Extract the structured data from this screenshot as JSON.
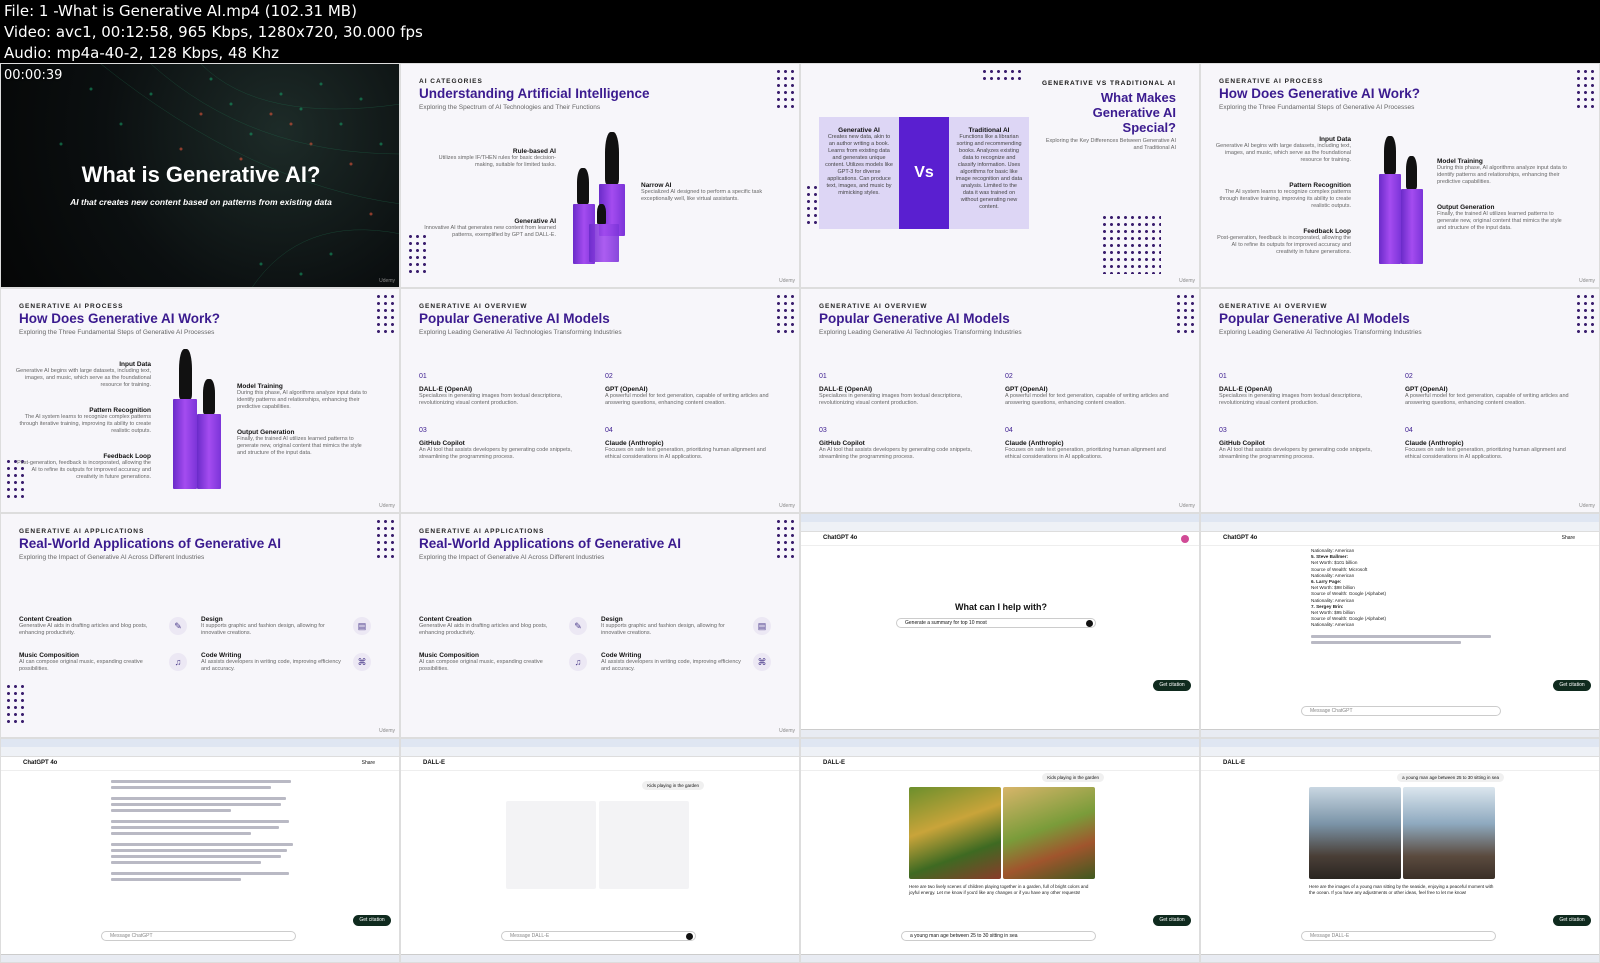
{
  "file_info": {
    "line1": "File: 1 -What is Generative AI.mp4 (102.31 MB)",
    "line2": "Video: avc1, 00:12:58, 965 Kbps, 1280x720, 30.000 fps",
    "line3": "Audio: mp4a-40-2, 128 Kbps, 48 Khz",
    "timestamp": "00:00:39"
  },
  "watermark": "Udemy",
  "tile1": {
    "title": "What is Generative AI?",
    "subtitle": "AI that creates new content based on patterns from existing data"
  },
  "tile2": {
    "kicker": "AI CATEGORIES",
    "title": "Understanding Artificial Intelligence",
    "subtitle": "Exploring the Spectrum of AI Technologies and Their Functions",
    "items": [
      {
        "label": "Rule-based AI",
        "desc": "Utilizes simple IF/THEN rules for basic decision-making, suitable for limited tasks."
      },
      {
        "label": "Narrow AI",
        "desc": "Specialized AI designed to perform a specific task exceptionally well, like virtual assistants."
      },
      {
        "label": "Generative AI",
        "desc": "Innovative AI that generates new content from learned patterns, exemplified by GPT and DALL-E."
      }
    ]
  },
  "tile3": {
    "kicker": "GENERATIVE VS TRADITIONAL AI",
    "title": "What Makes Generative AI Special?",
    "subtitle": "Exploring the Key Differences Between Generative AI and Traditional AI",
    "left_head": "Generative AI",
    "left_text": "Creates new data, akin to an author writing a book. Learns from existing data and generates unique content. Utilizes models like GPT-3 for diverse applications. Can produce text, images, and music by mimicking styles.",
    "vs": "Vs",
    "right_head": "Traditional AI",
    "right_text": "Functions like a librarian sorting and recommending books. Analyzes existing data to recognize and classify information. Uses algorithms for basic like image recognition and data analysis. Limited to the data it was trained on without generating new content."
  },
  "process": {
    "kicker": "GENERATIVE AI PROCESS",
    "title": "How Does Generative AI Work?",
    "subtitle": "Exploring the Three Fundamental Steps of Generative AI Processes",
    "steps": [
      {
        "label": "Input Data",
        "desc": "Generative AI begins with large datasets, including text, images, and music, which serve as the foundational resource for training."
      },
      {
        "label": "Model Training",
        "desc": "During this phase, AI algorithms analyze input data to identify patterns and relationships, enhancing their predictive capabilities."
      },
      {
        "label": "Pattern Recognition",
        "desc": "The AI system learns to recognize complex patterns through iterative training, improving its ability to create realistic outputs."
      },
      {
        "label": "Output Generation",
        "desc": "Finally, the trained AI utilizes learned patterns to generate new, original content that mimics the style and structure of the input data."
      },
      {
        "label": "Feedback Loop",
        "desc": "Post-generation, feedback is incorporated, allowing the AI to refine its outputs for improved accuracy and creativity in future generations."
      }
    ]
  },
  "models": {
    "kicker": "GENERATIVE AI OVERVIEW",
    "title": "Popular Generative AI Models",
    "subtitle": "Exploring Leading Generative AI Technologies Transforming Industries",
    "items": [
      {
        "num": "01",
        "label": "DALL-E (OpenAI)",
        "desc": "Specializes in generating images from textual descriptions, revolutionizing visual content production."
      },
      {
        "num": "02",
        "label": "GPT (OpenAI)",
        "desc": "A powerful model for text generation, capable of writing articles and answering questions, enhancing content creation."
      },
      {
        "num": "03",
        "label": "GitHub Copilot",
        "desc": "An AI tool that assists developers by generating code snippets, streamlining the programming process."
      },
      {
        "num": "04",
        "label": "Claude (Anthropic)",
        "desc": "Focuses on safe text generation, prioritizing human alignment and ethical considerations in AI applications."
      }
    ]
  },
  "apps": {
    "kicker": "GENERATIVE AI APPLICATIONS",
    "title": "Real-World Applications of Generative AI",
    "subtitle": "Exploring the Impact of Generative AI Across Different Industries",
    "items": [
      {
        "label": "Content Creation",
        "desc": "Generative AI aids in drafting articles and blog posts, enhancing productivity."
      },
      {
        "label": "Design",
        "desc": "It supports graphic and fashion design, allowing for innovative creations."
      },
      {
        "label": "Music Composition",
        "desc": "AI can compose original music, expanding creative possibilities."
      },
      {
        "label": "Code Writing",
        "desc": "AI assists developers in writing code, improving efficiency and accuracy."
      }
    ]
  },
  "chat": {
    "app_name": "ChatGPT 4o",
    "dalle_name": "DALL-E",
    "question": "What can I help with?",
    "prompt_draft": "Generate a summary for top 10 most",
    "message_placeholder": "Message ChatGPT",
    "dalle_placeholder": "Message DALL-E",
    "get_citation": "Get citation",
    "share": "Share",
    "user_msg_garden": "Kids playing in the garden",
    "user_msg_man": "a young man age between 25 to 30 sitting in sea",
    "reply_garden": "Here are two lively scenes of children playing together in a garden, full of bright colors and joyful energy. Let me know if you'd like any changes or if you have any other requests!",
    "reply_man": "Here are the images of a young man sitting by the seaside, enjoying a peaceful moment with the ocean. If you have any adjustments or other ideas, feel free to let me know!",
    "list_snippet": [
      "Nationality: American",
      "5. Steve Ballmer:",
      "Net Worth: $101 billion",
      "Source of Wealth: Microsoft",
      "Nationality: American",
      "6. Larry Page:",
      "Net Worth: $98 billion",
      "Source of Wealth: Google (Alphabet)",
      "Nationality: American",
      "7. Sergey Brin:",
      "Net Worth: $95 billion",
      "Source of Wealth: Google (Alphabet)",
      "Nationality: American"
    ]
  }
}
